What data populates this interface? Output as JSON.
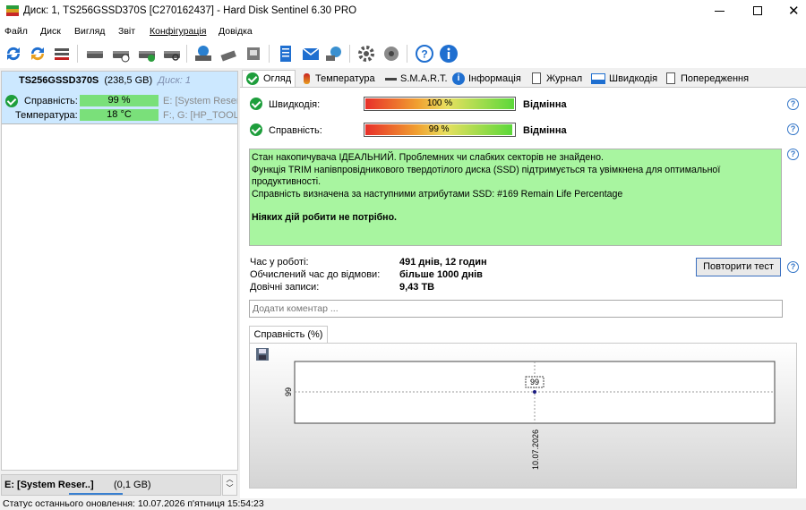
{
  "window": {
    "title": "Диск: 1, TS256GSSD370S [C270162437]  -  Hard Disk Sentinel 6.30 PRO"
  },
  "menu": [
    "Файл",
    "Диск",
    "Вигляд",
    "Звіт",
    "Конфігурація",
    "Довідка"
  ],
  "disk_list": {
    "disk_name": "TS256GSSD370S",
    "disk_size": "(238,5 GB)",
    "disk_index": "Диск: 1",
    "health_label": "Справність:",
    "health_value": "99 %",
    "health_vol": "E: [System Reserv",
    "temp_label": "Температура:",
    "temp_value": "18 °C",
    "temp_vol": "F:, G: [HP_TOOLS"
  },
  "volume_bar": {
    "name": "E: [System Reser..]",
    "size": "(0,1 GB)"
  },
  "tabs": [
    "Огляд",
    "Температура",
    "S.M.A.R.T.",
    "Інформація",
    "Журнал",
    "Швидкодія",
    "Попередження"
  ],
  "overview": {
    "speed_label": "Швидкодія:",
    "speed_value": "100 %",
    "speed_percent": 100,
    "speed_rating": "Відмінна",
    "health_label": "Справність:",
    "health_value": "99 %",
    "health_percent": 99,
    "health_rating": "Відмінна",
    "desc_line1": "Стан накопичувача ІДЕАЛЬНИЙ. Проблемних чи слабких секторів не знайдено.",
    "desc_line2": "Функція TRIM напівпровідникового твердотілого диска (SSD) підтримується та увімкнена для оптимальної",
    "desc_line3": "продуктивності.",
    "desc_line4": "Справність визначена за наступними атрибутами SSD:  #169 Remain Life Percentage",
    "desc_action": "Ніяких дій робити не потрібно.",
    "uptime_label": "Час у роботі:",
    "uptime_value": "491 днів, 12 годин",
    "ttf_label": "Обчислений час до відмови:",
    "ttf_value": "більше 1000 днів",
    "writes_label": "Довічні записи:",
    "writes_value": "9,43 TB",
    "retest_button": "Повторити тест",
    "comment_placeholder": "Додати коментар ..."
  },
  "chart_tab": "Справність (%)",
  "chart_data": {
    "type": "line",
    "x": [
      "10.07.2026"
    ],
    "values": [
      99
    ],
    "data_labels": [
      "99"
    ],
    "ytick": "99"
  },
  "status_bar": "Статус останнього оновлення: 10.07.2026 п'ятниця 15:54:23",
  "colors": {
    "ok_green": "#1e9e3c",
    "desc_bg": "#a8f5a0",
    "selection": "#cce8ff"
  }
}
